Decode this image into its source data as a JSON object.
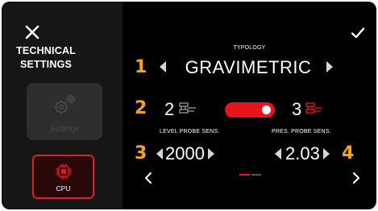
{
  "sidebar": {
    "title_line1": "TECHNICAL",
    "title_line2": "SETTINGS",
    "settings_label": "Settings",
    "cpu_label": "CPU"
  },
  "main": {
    "typology_label": "TYPOLOGY",
    "typology_value": "GRAVIMETRIC",
    "steps": [
      "1",
      "2",
      "3",
      "4"
    ],
    "probe_option_left": "2",
    "probe_option_right": "3",
    "probe_toggle_state": "3",
    "level_probe_label": "LEVEL PROBE SENS.",
    "level_probe_value": "2000",
    "pres_probe_label": "PRES. PROBE SENS.",
    "pres_probe_value": "2.03",
    "page_index": 1,
    "page_count": 2
  },
  "colors": {
    "accent_red": "#e8141b",
    "step_orange": "#f3a51e",
    "sidebar_bg": "#161616",
    "screen_bg": "#000000"
  },
  "icons": [
    "close-icon",
    "check-icon",
    "gear-icon",
    "cpu-icon",
    "probe-icon",
    "chevron-left-icon",
    "chevron-right-icon"
  ]
}
